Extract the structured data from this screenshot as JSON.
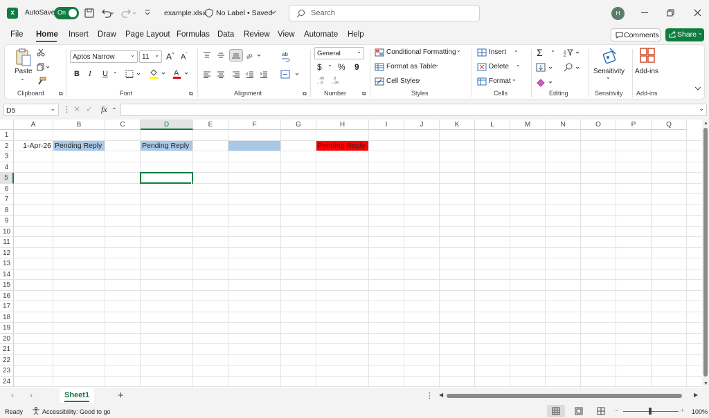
{
  "titlebar": {
    "autosave_label": "AutoSave",
    "autosave_state": "On",
    "filename": "example.xlsx",
    "label_status": "No Label • Saved",
    "search_placeholder": "Search",
    "avatar_initial": "H",
    "accent": "#107c41"
  },
  "menu_tabs": [
    "File",
    "Home",
    "Insert",
    "Draw",
    "Page Layout",
    "Formulas",
    "Data",
    "Review",
    "View",
    "Automate",
    "Help"
  ],
  "active_tab": "Home",
  "comments_label": "Comments",
  "share_label": "Share",
  "ribbon": {
    "clipboard": {
      "paste": "Paste",
      "group": "Clipboard"
    },
    "font": {
      "name": "Aptos Narrow",
      "size": "11",
      "group": "Font",
      "bold": "B",
      "italic": "I",
      "underline": "U"
    },
    "alignment": {
      "group": "Alignment"
    },
    "number": {
      "format": "General",
      "group": "Number",
      "currency": "$",
      "percent": "%",
      "comma": "9"
    },
    "styles": {
      "conditional": "Conditional Formatting",
      "table": "Format as Table",
      "cell": "Cell Styles",
      "group": "Styles"
    },
    "cells": {
      "insert": "Insert",
      "delete": "Delete",
      "format": "Format",
      "group": "Cells"
    },
    "editing": {
      "group": "Editing",
      "sum": "Σ"
    },
    "sensitivity": {
      "label": "Sensitivity",
      "group": "Sensitivity"
    },
    "addins": {
      "label": "Add-ins",
      "group": "Add-ins"
    }
  },
  "formula_bar": {
    "name_box": "D5",
    "fx": "fx",
    "value": ""
  },
  "columns": [
    "A",
    "B",
    "C",
    "D",
    "E",
    "F",
    "G",
    "H",
    "I",
    "J",
    "K",
    "L",
    "M",
    "N",
    "O",
    "P",
    "Q"
  ],
  "rows": [
    "1",
    "2",
    "3",
    "4",
    "5",
    "6",
    "7",
    "8",
    "9",
    "10",
    "11",
    "12",
    "13",
    "14",
    "15",
    "16",
    "17",
    "18",
    "19",
    "20",
    "21",
    "22",
    "23",
    "24"
  ],
  "cells": {
    "A2": "1-Apr-26",
    "B2": "Pending Reply",
    "D2": "Pending Reply",
    "F2": "",
    "H2": "Pending Reply"
  },
  "cell_colors": {
    "blue": "#a9c8e8",
    "red": "#ff0000"
  },
  "selected_cell": "D5",
  "sheet_tabs": [
    "Sheet1"
  ],
  "status": {
    "ready": "Ready",
    "accessibility": "Accessibility: Good to go",
    "zoom": "100%"
  }
}
